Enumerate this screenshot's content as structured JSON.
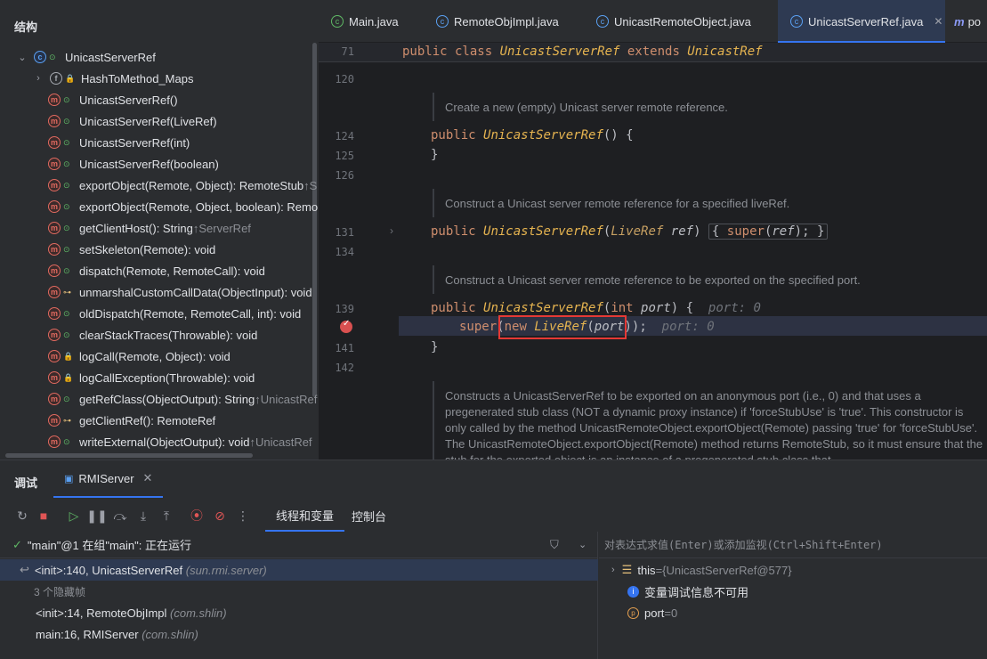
{
  "structure": {
    "title": "结构",
    "root": {
      "label": "UnicastServerRef"
    },
    "items": [
      {
        "label": "HashToMethod_Maps",
        "suffix": "",
        "kind": "class-field",
        "vis": "private"
      },
      {
        "label": "UnicastServerRef()",
        "suffix": "",
        "kind": "method",
        "vis": "public"
      },
      {
        "label": "UnicastServerRef(LiveRef)",
        "suffix": "",
        "kind": "method",
        "vis": "public"
      },
      {
        "label": "UnicastServerRef(int)",
        "suffix": "",
        "kind": "method",
        "vis": "public"
      },
      {
        "label": "UnicastServerRef(boolean)",
        "suffix": "",
        "kind": "method",
        "vis": "public"
      },
      {
        "label": "exportObject(Remote, Object): RemoteStub",
        "suffix": " ↑S",
        "kind": "method",
        "vis": "public"
      },
      {
        "label": "exportObject(Remote, Object, boolean): Remo",
        "suffix": "",
        "kind": "method",
        "vis": "public"
      },
      {
        "label": "getClientHost(): String",
        "suffix": " ↑ServerRef",
        "kind": "method",
        "vis": "public"
      },
      {
        "label": "setSkeleton(Remote): void",
        "suffix": "",
        "kind": "method",
        "vis": "public"
      },
      {
        "label": "dispatch(Remote, RemoteCall): void",
        "suffix": "",
        "kind": "method",
        "vis": "public"
      },
      {
        "label": "unmarshalCustomCallData(ObjectInput): void",
        "suffix": "",
        "kind": "method",
        "vis": "protected"
      },
      {
        "label": "oldDispatch(Remote, RemoteCall, int): void",
        "suffix": "",
        "kind": "method",
        "vis": "public"
      },
      {
        "label": "clearStackTraces(Throwable): void",
        "suffix": "",
        "kind": "method-static",
        "vis": "public"
      },
      {
        "label": "logCall(Remote, Object): void",
        "suffix": "",
        "kind": "method",
        "vis": "private"
      },
      {
        "label": "logCallException(Throwable): void",
        "suffix": "",
        "kind": "method",
        "vis": "private"
      },
      {
        "label": "getRefClass(ObjectOutput): String",
        "suffix": " ↑UnicastRef",
        "kind": "method",
        "vis": "public"
      },
      {
        "label": "getClientRef(): RemoteRef",
        "suffix": "",
        "kind": "method",
        "vis": "protected"
      },
      {
        "label": "writeExternal(ObjectOutput): void",
        "suffix": " ↑UnicastRef",
        "kind": "method",
        "vis": "public"
      }
    ]
  },
  "tabs": [
    {
      "label": "Main.java"
    },
    {
      "label": "RemoteObjImpl.java"
    },
    {
      "label": "UnicastRemoteObject.java"
    },
    {
      "label": "UnicastServerRef.java"
    },
    {
      "label": "po"
    }
  ],
  "editor": {
    "sticky": {
      "line": "71",
      "code_kw": "public class ",
      "code_cls": "UnicastServerRef",
      "code_kw2": " extends ",
      "code_super": "UnicastRef"
    },
    "lines": {
      "l120": "120",
      "l124": "124",
      "l125": "125",
      "l126": "126",
      "l131": "131",
      "l134": "134",
      "l139": "139",
      "l141": "141",
      "l142": "142"
    },
    "doc1": "Create a new (empty) Unicast server remote reference.",
    "doc2": "Construct a Unicast server remote reference for a specified liveRef.",
    "doc3": "Construct a Unicast server remote reference to be exported on the specified port.",
    "doc4": "Constructs a UnicastServerRef to be exported on an anonymous port (i.e., 0) and that uses a pregenerated stub class (NOT a dynamic proxy instance) if 'forceStubUse' is 'true'. This constructor is only called by the method UnicastRemoteObject.exportObject(Remote) passing 'true' for 'forceStubUse'. The UnicastRemoteObject.exportObject(Remote) method returns RemoteStub, so it must ensure that the stub for the exported object is an instance of a pregenerated stub class that",
    "hint_port": "port: 0",
    "hint_port2": "port: 0"
  },
  "debug": {
    "title": "调试",
    "run_tab": "RMIServer",
    "tab_threads": "线程和变量",
    "tab_console": "控制台",
    "thread_status": "\"main\"@1 在组\"main\": 正在运行",
    "eval_placeholder": "对表达式求值(Enter)或添加监视(Ctrl+Shift+Enter)",
    "frames": [
      {
        "method": "<init>:140, UnicastServerRef",
        "pkg": "(sun.rmi.server)"
      },
      {
        "method": "3 个隐藏帧",
        "pkg": ""
      },
      {
        "method": "<init>:14, RemoteObjImpl",
        "pkg": "(com.shlin)"
      },
      {
        "method": "main:16, RMIServer",
        "pkg": "(com.shlin)"
      }
    ],
    "vars": [
      {
        "name": "this",
        "eq": " = ",
        "value": "{UnicastServerRef@577}"
      },
      {
        "name": "变量调试信息不可用",
        "eq": "",
        "value": ""
      },
      {
        "name": "port",
        "eq": " = ",
        "value": "0"
      }
    ]
  }
}
